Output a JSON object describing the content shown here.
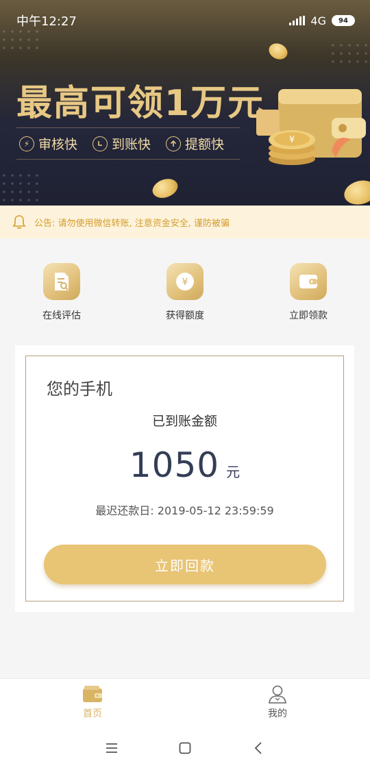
{
  "status_bar": {
    "time": "中午12:27",
    "network": "4G",
    "battery": "94"
  },
  "banner": {
    "headline": "最高可领1万元",
    "features": [
      {
        "icon": "lightning-icon",
        "label": "审核快"
      },
      {
        "icon": "clock-icon",
        "label": "到账快"
      },
      {
        "icon": "arrow-up-icon",
        "label": "提额快"
      }
    ]
  },
  "notice": {
    "icon": "bell-icon",
    "text": "公告: 请勿使用微信转账, 注意资金安全, 谨防被骗"
  },
  "actions": [
    {
      "icon": "document-search-icon",
      "label": "在线评估"
    },
    {
      "icon": "yuan-coin-icon",
      "label": "获得额度"
    },
    {
      "icon": "wallet-icon",
      "label": "立即领款"
    }
  ],
  "card": {
    "title": "您的手机",
    "subtitle": "已到账金额",
    "amount": "1050",
    "unit": "元",
    "due_label": "最迟还款日:",
    "due_date": "2019-05-12 23:59:59",
    "button": "立即回款"
  },
  "tabbar": {
    "home": "首页",
    "mine": "我的"
  },
  "colors": {
    "accent": "#e8c475",
    "notice_bg": "#fdf3dc",
    "notice_text": "#d49c2c",
    "amount": "#343d56"
  }
}
